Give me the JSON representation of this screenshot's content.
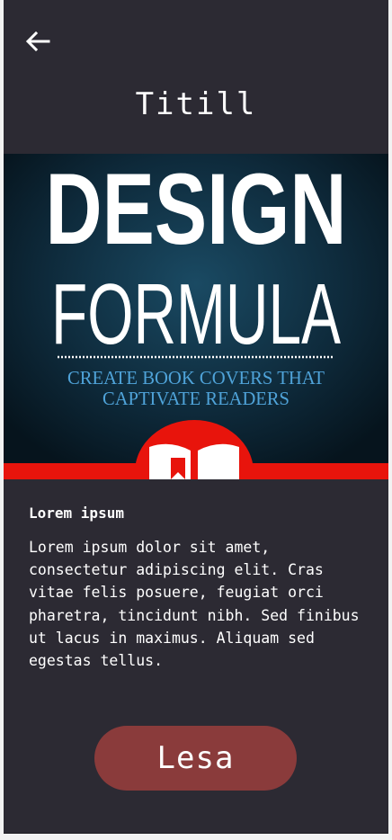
{
  "header": {
    "title": "Titill"
  },
  "book": {
    "cover_title_line1": "DESIGN",
    "cover_title_line2": "FORMULA",
    "cover_subtitle_line1": "CREATE BOOK COVERS THAT",
    "cover_subtitle_line2": "CAPTIVATE READERS"
  },
  "description": {
    "heading": "Lorem ipsum",
    "body": "Lorem ipsum dolor sit amet, consectetur adipiscing elit. Cras vitae felis posuere, feugiat orci pharetra, tincidunt nibh. Sed finibus ut lacus in maximus. Aliquam sed egestas tellus."
  },
  "actions": {
    "read_label": "Lesa"
  },
  "colors": {
    "background": "#2c2a33",
    "button": "#8a3b3b",
    "cover_accent": "#e8140c",
    "cover_subtitle": "#4fa3d9"
  },
  "icons": {
    "back": "arrow-left-icon",
    "book": "open-book-icon"
  }
}
